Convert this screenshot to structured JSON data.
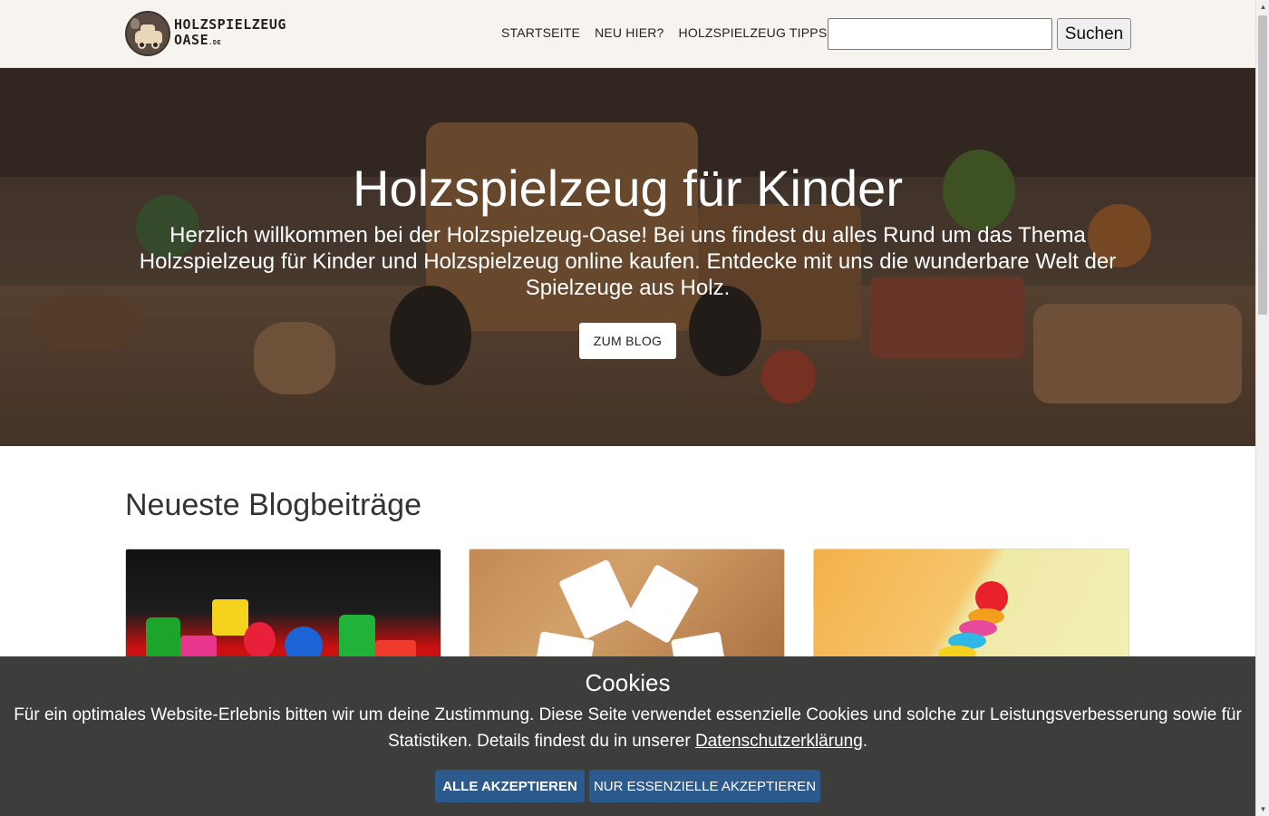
{
  "header": {
    "logo": {
      "line1": "HOLZSPIELZEUG",
      "line2": "OASE",
      "suffix": ".DE"
    },
    "nav": [
      {
        "label": "STARTSEITE"
      },
      {
        "label": "NEU HIER?"
      },
      {
        "label": "HOLZSPIELZEUG TIPPS"
      }
    ],
    "search": {
      "value": "",
      "button_label": "Suchen"
    }
  },
  "hero": {
    "title": "Holzspielzeug für Kinder",
    "text": "Herzlich willkommen bei der Holzspielzeug-Oase! Bei uns findest du alles Rund um das Thema Holzspielzeug für Kinder und Holzspielzeug online kaufen. Entdecke mit uns die wunderbare Welt der Spielzeuge aus Holz.",
    "button_label": "ZUM BLOG"
  },
  "blog": {
    "title": "Neueste Blogbeiträge"
  },
  "cookie": {
    "title": "Cookies",
    "text_before_link": "Für ein optimales Website-Erlebnis bitten wir um deine Zustimmung. Diese Seite verwendet essenzielle Cookies und solche zur Leistungsverbesserung sowie für Statistiken. Details findest du in unserer ",
    "link_label": "Datenschutzerklärung",
    "text_after_link": ".",
    "accept_all_label": "ALLE AKZEPTIEREN",
    "accept_essential_label": "NUR ESSENZIELLE AKZEPTIEREN"
  },
  "colors": {
    "header_bg": "#f7f4ef",
    "cookie_bg": "#3d3d3b",
    "cookie_button": "#2d5a8c"
  }
}
